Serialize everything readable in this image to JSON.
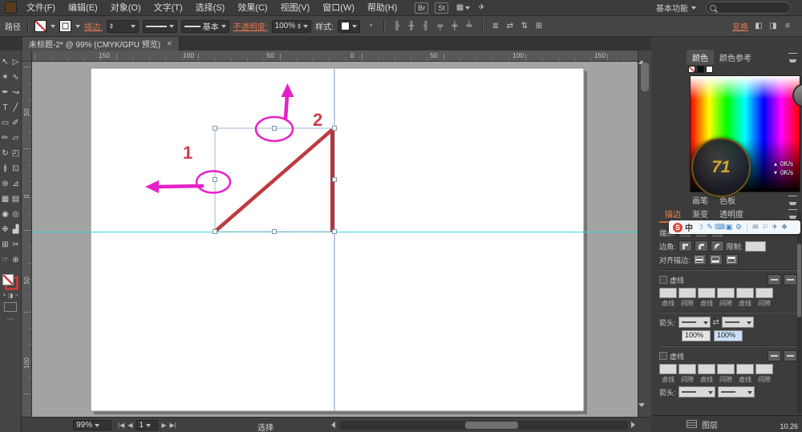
{
  "menubar": {
    "items": [
      "文件(F)",
      "编辑(E)",
      "对象(O)",
      "文字(T)",
      "选择(S)",
      "效果(C)",
      "视图(V)",
      "窗口(W)",
      "帮助(H)"
    ],
    "badges": [
      {
        "name": "bridge-badge",
        "label": "Br"
      },
      {
        "name": "stock-badge",
        "label": "St"
      }
    ],
    "arrange_glyph": "▦",
    "gpu_glyph": "✈",
    "workspace_label": "基本功能",
    "search_value": ""
  },
  "control_bar": {
    "context_label": "路径",
    "stroke_link": "描边:",
    "stroke_width_value": "",
    "brush_value": "基本",
    "opacity_link": "不透明度:",
    "opacity_value": "100%",
    "style_label": "样式:",
    "transform_link": "变换",
    "align_icons": [
      {
        "name": "align-left-icon",
        "glyph": "╟"
      },
      {
        "name": "align-h-center-icon",
        "glyph": "╫"
      },
      {
        "name": "align-right-icon",
        "glyph": "╢"
      },
      {
        "name": "align-top-icon",
        "glyph": "╤"
      },
      {
        "name": "align-v-center-icon",
        "glyph": "╪"
      },
      {
        "name": "align-bottom-icon",
        "glyph": "╧"
      }
    ],
    "more_icons": [
      {
        "name": "distribute-icon",
        "glyph": "≣"
      },
      {
        "name": "swap-icon",
        "glyph": "⇄"
      },
      {
        "name": "arrange-icon",
        "glyph": "⇅"
      },
      {
        "name": "isolate-icon",
        "glyph": "⊞"
      }
    ],
    "right_icons": [
      {
        "name": "shape-mode-icon",
        "glyph": "◧"
      },
      {
        "name": "pathfinder-icon",
        "glyph": "◨"
      },
      {
        "name": "panel-options-icon",
        "glyph": "≡"
      }
    ]
  },
  "document_tab": {
    "title": "未标题-2* @ 99% (CMYK/GPU 预览)",
    "close_glyph": "×"
  },
  "tools": [
    {
      "name": "selection-tool",
      "glyph": "↖"
    },
    {
      "name": "direct-selection-tool",
      "glyph": "▷"
    },
    {
      "name": "magic-wand-tool",
      "glyph": "✶"
    },
    {
      "name": "lasso-tool",
      "glyph": "∿"
    },
    {
      "name": "pen-tool",
      "glyph": "✒"
    },
    {
      "name": "curvature-tool",
      "glyph": "↝"
    },
    {
      "name": "type-tool",
      "glyph": "T"
    },
    {
      "name": "line-tool",
      "glyph": "╱"
    },
    {
      "name": "rectangle-tool",
      "glyph": "▭"
    },
    {
      "name": "paintbrush-tool",
      "glyph": "✐"
    },
    {
      "name": "pencil-tool",
      "glyph": "✏"
    },
    {
      "name": "shaper-tool",
      "glyph": "▱"
    },
    {
      "name": "rotate-tool",
      "glyph": "↻"
    },
    {
      "name": "scale-tool",
      "glyph": "◰"
    },
    {
      "name": "width-tool",
      "glyph": "≬"
    },
    {
      "name": "free-transform-tool",
      "glyph": "⊡"
    },
    {
      "name": "shape-builder-tool",
      "glyph": "⊛"
    },
    {
      "name": "perspective-grid-tool",
      "glyph": "⊿"
    },
    {
      "name": "mesh-tool",
      "glyph": "▦"
    },
    {
      "name": "gradient-tool",
      "glyph": "▤"
    },
    {
      "name": "eyedropper-tool",
      "glyph": "◉"
    },
    {
      "name": "blend-tool",
      "glyph": "◎"
    },
    {
      "name": "symbol-sprayer-tool",
      "glyph": "❉"
    },
    {
      "name": "column-graph-tool",
      "glyph": "▟"
    },
    {
      "name": "artboard-tool",
      "glyph": "⊞"
    },
    {
      "name": "slice-tool",
      "glyph": "✂"
    },
    {
      "name": "hand-tool",
      "glyph": "☞"
    },
    {
      "name": "zoom-tool",
      "glyph": "⊕"
    }
  ],
  "toolbar_footer": {
    "more_glyph": "⋯"
  },
  "rulers": {
    "top": [
      "150",
      "100",
      "50",
      "0",
      "50",
      "100",
      "150"
    ],
    "left": [
      "50",
      "0",
      "50",
      "100"
    ]
  },
  "canvas": {
    "label_1": "1",
    "label_2": "2"
  },
  "status_bar": {
    "zoom_value": "99%",
    "nav_prev": [
      "|◀",
      "◀"
    ],
    "nav_next": [
      "▶",
      "▶|"
    ],
    "artboard_value": "1",
    "tool_hint": "选择"
  },
  "right_panel": {
    "color_tab_1": "颜色",
    "color_tab_2": "颜色参考",
    "brush_tab": "画笔",
    "swatch_tab": "色板",
    "stroke_tab": "描边",
    "gradient_tab": "渐变",
    "transparency_tab": "透明度",
    "stroke": {
      "cap_label": "端点:",
      "corner_label": "边角:",
      "limit_label": "限制:",
      "limit_value": "",
      "align_label": "对齐描边:",
      "dash_label": "虚线",
      "dash_field_labels": [
        "虚线",
        "间隙",
        "虚线",
        "间隙",
        "虚线",
        "间隙"
      ],
      "arrow_label": "箭头:",
      "scale_values": [
        "100%",
        "100%"
      ],
      "dash2_label": "虚线",
      "arrow2_label": "箭头:"
    },
    "layers_label": "图层"
  },
  "overlays": {
    "net_up": "0K/s",
    "net_down": "0K/s",
    "badge_text": "71",
    "corner_text": "10.26",
    "ime": {
      "logo": "S",
      "lang": "中",
      "icons": [
        {
          "name": "moon-icon",
          "glyph": "☽"
        },
        {
          "name": "handwriting-icon",
          "glyph": "✎"
        },
        {
          "name": "keyboard-icon",
          "glyph": "⌨"
        },
        {
          "name": "clipboard-icon",
          "glyph": "▣"
        },
        {
          "name": "settings-icon",
          "glyph": "⚙"
        }
      ],
      "tray": [
        {
          "name": "mail-icon",
          "glyph": "✉"
        },
        {
          "name": "flag-icon",
          "glyph": "⚐"
        },
        {
          "name": "network-icon",
          "glyph": "✈"
        },
        {
          "name": "chat-icon",
          "glyph": "❖"
        }
      ]
    }
  },
  "colors": {
    "path_red": "#bf3a41",
    "annotation_magenta": "#e620c8",
    "annotation_label_red": "#d13c4a",
    "guide_cyan": "#3fd6d6",
    "guide_blue": "#7d97cf",
    "selection_blue": "#9fb9cf",
    "link_orange": "#e2754e"
  }
}
